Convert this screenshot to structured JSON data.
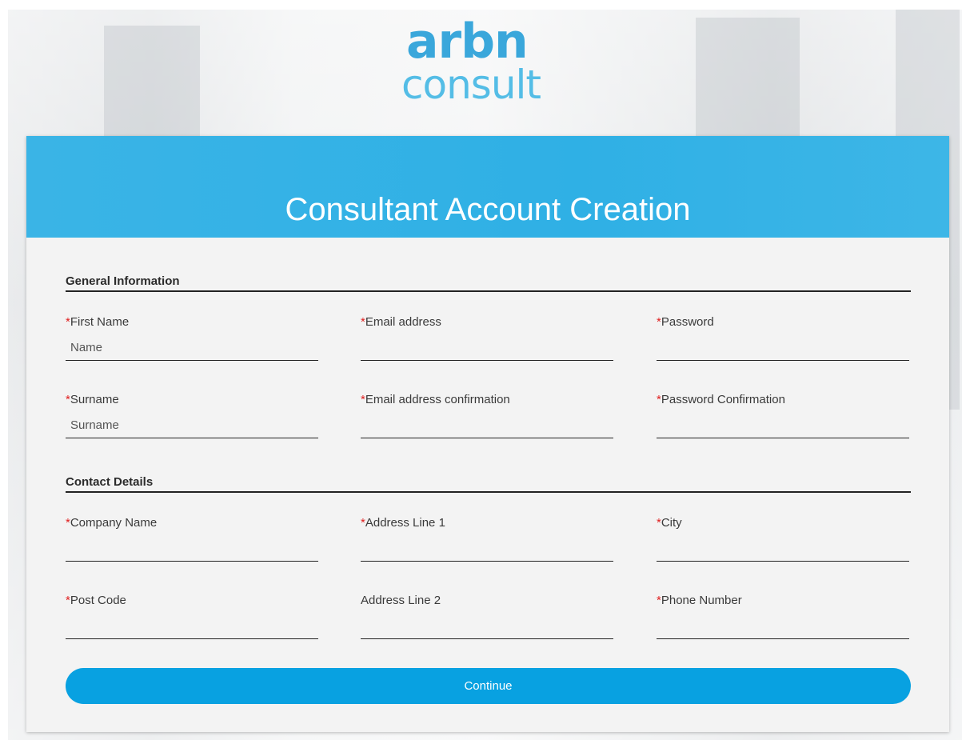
{
  "logo": {
    "line1": "arbn",
    "line2": "consult"
  },
  "header": {
    "title": "Consultant Account Creation"
  },
  "sections": {
    "general": "General Information",
    "contact": "Contact Details"
  },
  "required_marker": "*",
  "fields": {
    "first_name": {
      "label": "First Name",
      "placeholder": "Name",
      "value": ""
    },
    "email": {
      "label": "Email address",
      "placeholder": "",
      "value": ""
    },
    "password": {
      "label": "Password",
      "placeholder": "",
      "value": ""
    },
    "surname": {
      "label": "Surname",
      "placeholder": "Surname",
      "value": ""
    },
    "email_confirm": {
      "label": "Email address confirmation",
      "placeholder": "",
      "value": ""
    },
    "password_confirm": {
      "label": "Password Confirmation",
      "placeholder": "",
      "value": ""
    },
    "company_name": {
      "label": "Company Name",
      "placeholder": "",
      "value": ""
    },
    "address1": {
      "label": "Address Line 1",
      "placeholder": "",
      "value": ""
    },
    "city": {
      "label": "City",
      "placeholder": "",
      "value": ""
    },
    "post_code": {
      "label": "Post Code",
      "placeholder": "",
      "value": ""
    },
    "address2": {
      "label": "Address Line 2",
      "placeholder": "",
      "value": ""
    },
    "phone": {
      "label": "Phone Number",
      "placeholder": "",
      "value": ""
    }
  },
  "continue_label": "Continue",
  "colors": {
    "brand_blue": "#2fb0e5",
    "button_blue": "#08a1e1",
    "required_red": "#e02020"
  }
}
